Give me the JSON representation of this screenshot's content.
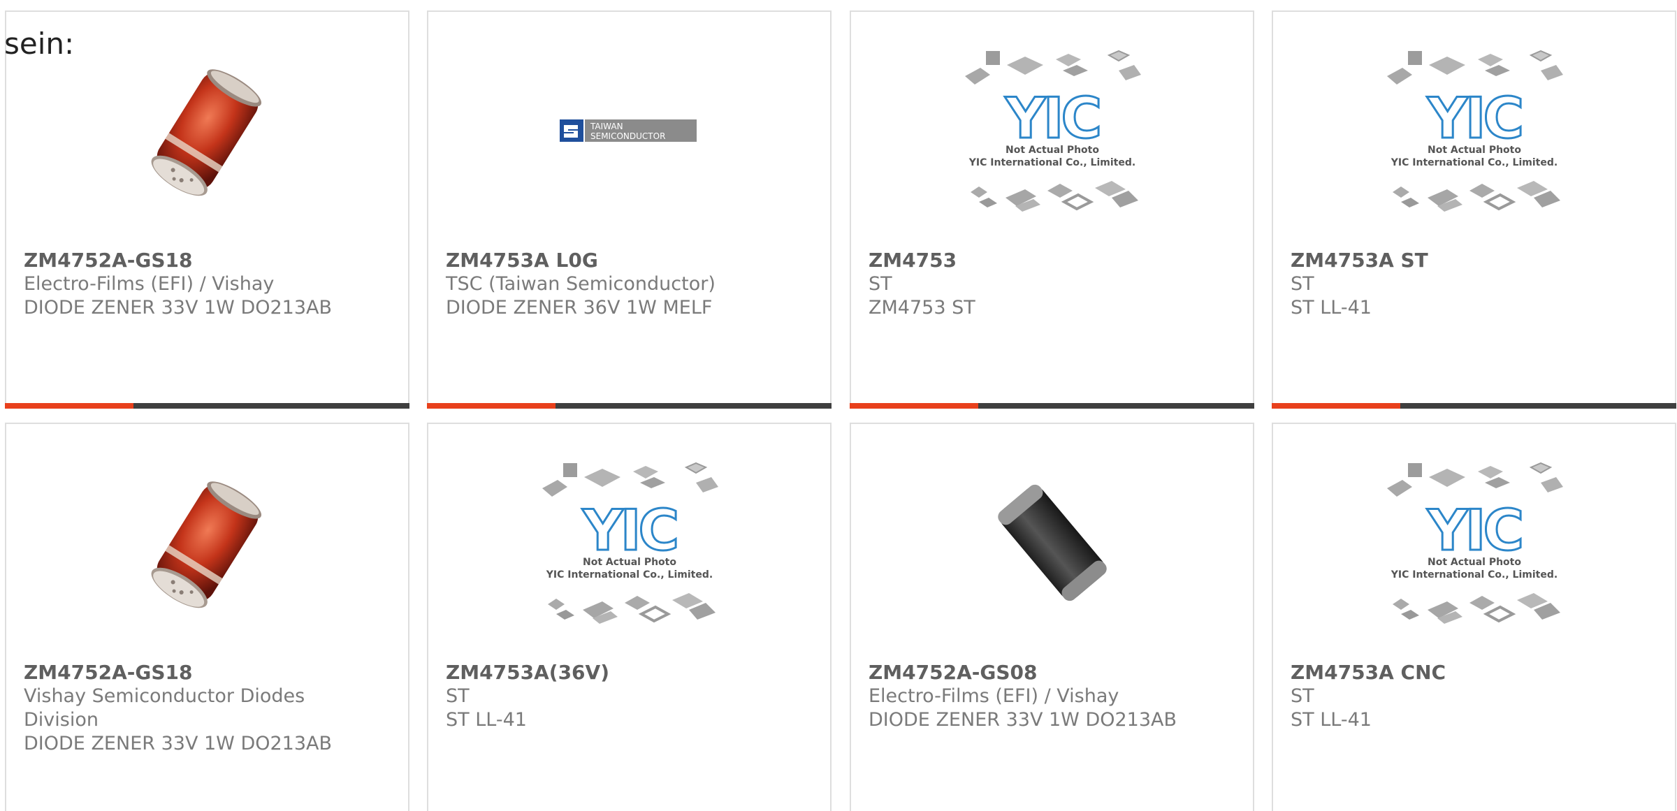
{
  "lead_text": "sein:",
  "cards": [
    {
      "part": "ZM4752A-GS18",
      "manufacturer": "Electro-Films (EFI) / Vishay",
      "description": "DIODE ZENER 33V 1W DO213AB",
      "image": "red-melf-diode-photo"
    },
    {
      "part": "ZM4753A L0G",
      "manufacturer": "TSC (Taiwan Semiconductor)",
      "description": "DIODE ZENER 36V 1W MELF",
      "image": "taiwan-semiconductor-logo",
      "logo_text": [
        "TAIWAN",
        "SEMICONDUCTOR"
      ]
    },
    {
      "part": "ZM4753",
      "manufacturer": "ST",
      "description": "ZM4753 ST",
      "image": "yic-placeholder"
    },
    {
      "part": "ZM4753A ST",
      "manufacturer": "ST",
      "description": "ST LL-41",
      "image": "yic-placeholder"
    },
    {
      "part": "ZM4752A-GS18",
      "manufacturer": "Vishay Semiconductor Diodes Division",
      "description": "DIODE ZENER 33V 1W DO213AB",
      "image": "red-melf-diode-photo"
    },
    {
      "part": "ZM4753A(36V)",
      "manufacturer": "ST",
      "description": "ST LL-41",
      "image": "yic-placeholder"
    },
    {
      "part": "ZM4752A-GS08",
      "manufacturer": "Electro-Films (EFI) / Vishay",
      "description": "DIODE ZENER 33V 1W DO213AB",
      "image": "black-melf-diode-photo"
    },
    {
      "part": "ZM4753A CNC",
      "manufacturer": "ST",
      "description": "ST LL-41",
      "image": "yic-placeholder"
    }
  ],
  "yic": {
    "logo": "YIC",
    "line1": "Not Actual Photo",
    "line2": "YIC International Co., Limited."
  },
  "colors": {
    "accent": "#e8401c",
    "bar": "#3f3f3f",
    "border": "#dedede",
    "part_text": "#5f5f5f",
    "meta_text": "#7a7a7a"
  }
}
